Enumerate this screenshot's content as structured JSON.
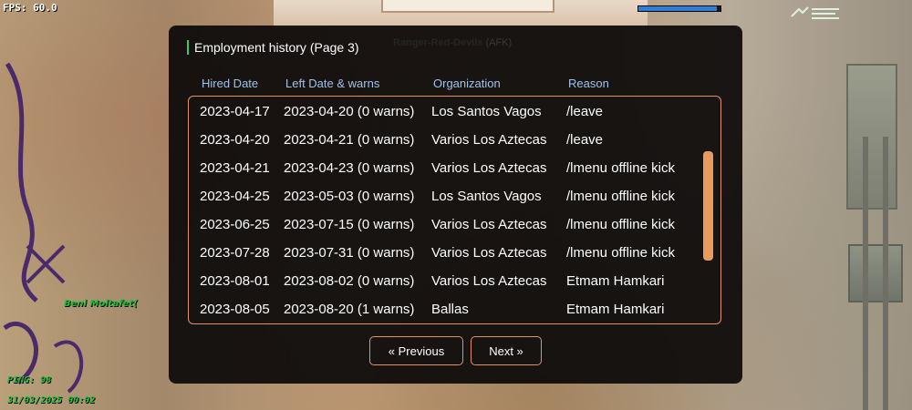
{
  "hud": {
    "fps": "FPS: 60.0",
    "ping": "PING: 98",
    "datetime": "31/03/2025 00:02",
    "player_name": "Beni Moltafet(",
    "health_level": 0.95
  },
  "overhead": {
    "name": "Ranger-Red-Devils",
    "tag": "(AFK)"
  },
  "dialog": {
    "title": "Employment history (Page 3)",
    "columns": [
      "Hired Date",
      "Left Date & warns",
      "Organization",
      "Reason"
    ],
    "rows": [
      [
        "2023-04-17",
        "2023-04-20 (0 warns)",
        "Los Santos Vagos",
        "/leave"
      ],
      [
        "2023-04-20",
        "2023-04-21 (0 warns)",
        "Varios Los Aztecas",
        "/leave"
      ],
      [
        "2023-04-21",
        "2023-04-23 (0 warns)",
        "Varios Los Aztecas",
        "/lmenu offline kick"
      ],
      [
        "2023-04-25",
        "2023-05-03 (0 warns)",
        "Los Santos Vagos",
        "/lmenu offline kick"
      ],
      [
        "2023-06-25",
        "2023-07-15 (0 warns)",
        "Varios Los Aztecas",
        "/lmenu offline kick"
      ],
      [
        "2023-07-28",
        "2023-07-31 (0 warns)",
        "Varios Los Aztecas",
        "/lmenu offline kick"
      ],
      [
        "2023-08-01",
        "2023-08-02 (0 warns)",
        "Varios Los Aztecas",
        "Etmam Hamkari"
      ],
      [
        "2023-08-05",
        "2023-08-20 (1 warns)",
        "Ballas",
        "Etmam Hamkari"
      ]
    ],
    "prev_label": "« Previous",
    "next_label": "Next »"
  },
  "colors": {
    "accent": "#e0936a",
    "scroll_thumb": "#e89b5c",
    "header_text": "#9fc3ea",
    "title_marker": "#2ecc71",
    "hud_green": "#1fbf3a"
  }
}
